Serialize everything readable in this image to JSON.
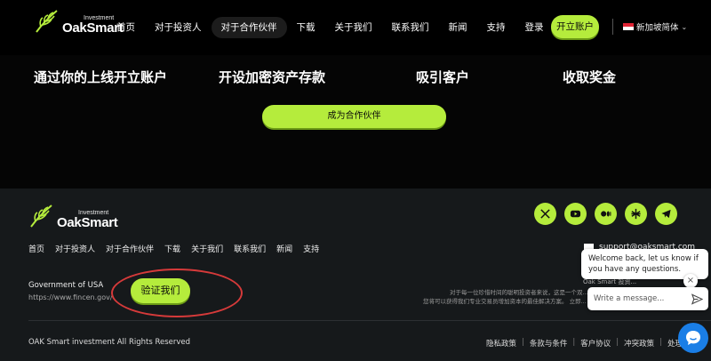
{
  "brand": {
    "small": "Investment",
    "name": "OakSmart"
  },
  "nav": {
    "items": [
      {
        "label": "首页"
      },
      {
        "label": "对于投资人"
      },
      {
        "label": "对于合作伙伴",
        "active": true
      },
      {
        "label": "下载"
      },
      {
        "label": "关于我们"
      },
      {
        "label": "联系我们"
      },
      {
        "label": "新闻"
      },
      {
        "label": "支持"
      },
      {
        "label": "登录"
      }
    ],
    "open_account": "开立账户",
    "language": "新加坡简体"
  },
  "steps": [
    "通过你的上线开立账户",
    "开设加密资产存款",
    "吸引客户",
    "收取奖金"
  ],
  "partner_button": "成为合作伙伴",
  "footer": {
    "socials": [
      "x-icon",
      "youtube-icon",
      "medium-icon",
      "linktree-icon",
      "telegram-icon"
    ],
    "nav": [
      "首页",
      "对于投资人",
      "对于合作伙伴",
      "下载",
      "关于我们",
      "联系我们",
      "新闻",
      "支持"
    ],
    "email": "support@oaksmart.com",
    "gov_title": "Government of USA",
    "gov_url": "https://www.fincen.gov/",
    "verify_button": "验证我们",
    "right_name": "Oak Smart 投资...",
    "desc_line1": "对于每一位珍惜时间的聪明投资者来说，这是一个双...",
    "desc_line2": "您将可以获得我们专业交易员增加资本的最佳解决方案。 立即...",
    "copyright": "OAK Smart investment All Rights Reserved",
    "legal": [
      "隐私政策",
      "条款与条件",
      "客户协议",
      "冲突政策",
      "处理政策"
    ]
  },
  "chat": {
    "greeting": "Welcome back, let us know if you have any questions.",
    "placeholder": "Write a message...",
    "close": "×"
  },
  "colors": {
    "accent": "#b5ec3c",
    "background": "#050505",
    "footer": "#16191b",
    "chat": "#1a7ee6",
    "highlight": "#d63a3a"
  }
}
